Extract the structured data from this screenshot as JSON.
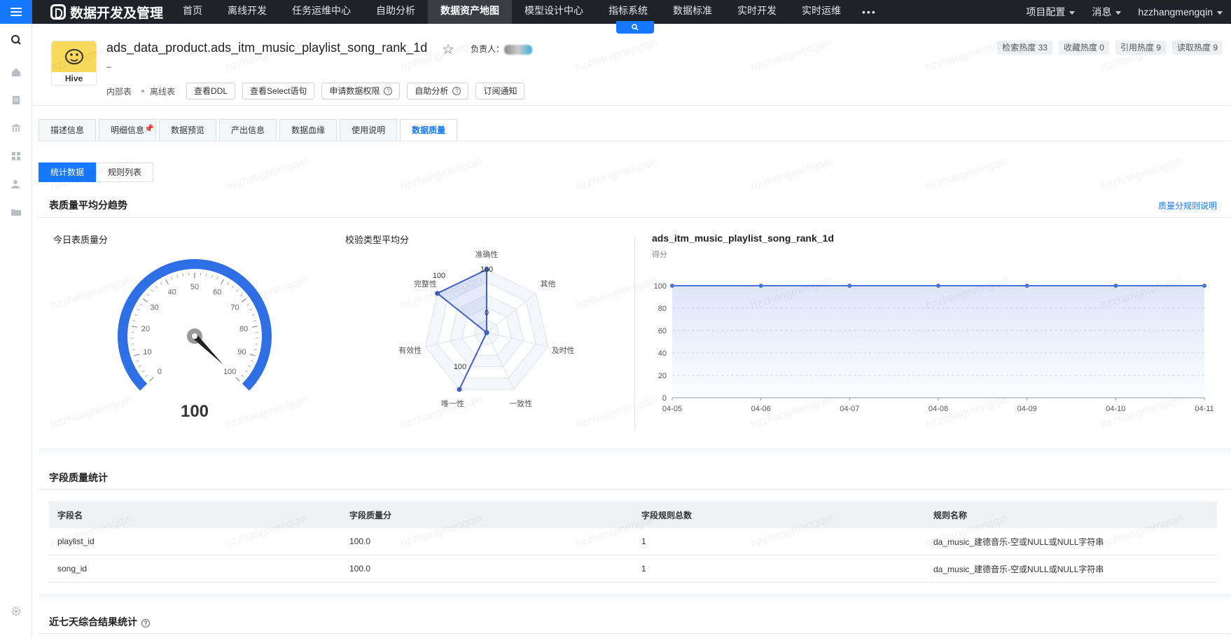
{
  "app": {
    "title": "数据开发及管理"
  },
  "nav": {
    "items": [
      "首页",
      "离线开发",
      "任务运维中心",
      "自助分析",
      "数据资产地图",
      "模型设计中心",
      "指标系统",
      "数据标准",
      "实时开发",
      "实时运维"
    ],
    "active": "数据资产地图",
    "more": "•••",
    "right": [
      "项目配置",
      "消息",
      "hzzhangmengqin"
    ]
  },
  "asset": {
    "engine_label": "Hive",
    "table_name": "ads_data_product.ads_itm_music_playlist_song_rank_1d",
    "dash": "–",
    "owner_label": "负责人：",
    "meta": [
      "内部表",
      "离线表"
    ],
    "actions": [
      "查看DDL",
      "查看Select语句",
      "申请数据权限",
      "自助分析",
      "订阅通知"
    ],
    "heat": [
      "检索热度 33",
      "收藏热度 0",
      "引用热度 9",
      "读取热度 9"
    ]
  },
  "tabs": [
    "描述信息",
    "明细信息",
    "数据预览",
    "产出信息",
    "数据血缘",
    "使用说明",
    "数据质量"
  ],
  "tabs_active": "数据质量",
  "subtabs": [
    "统计数据",
    "规则列表"
  ],
  "subtabs_active": "统计数据",
  "trend": {
    "title": "表质量平均分趋势",
    "help_link": "质量分规则说明",
    "gauge_title": "今日表质量分",
    "gauge_value": "100",
    "radar_title": "校验类型平均分",
    "line_title": "ads_itm_music_playlist_song_rank_1d",
    "line_subtitle": "得分"
  },
  "chart_data": [
    {
      "type": "gauge",
      "title": "今日表质量分",
      "value": 100,
      "min": 0,
      "max": 100,
      "ticks": [
        "0",
        "10",
        "20",
        "30",
        "40",
        "50",
        "60",
        "70",
        "80",
        "90",
        "100"
      ]
    },
    {
      "type": "radar",
      "title": "校验类型平均分",
      "indicators": [
        "准确性",
        "其他",
        "及时性",
        "一致性",
        "唯一性",
        "有效性",
        "完整性"
      ],
      "values": [
        100,
        0,
        0,
        0,
        100,
        0,
        100
      ],
      "max": 100,
      "labels": [
        "100",
        "0",
        "100",
        "100"
      ]
    },
    {
      "type": "area",
      "categories": [
        "04-05",
        "04-06",
        "04-07",
        "04-08",
        "04-09",
        "04-10",
        "04-11"
      ],
      "series": [
        {
          "values": [
            100,
            100,
            100,
            100,
            100,
            100,
            100
          ]
        }
      ],
      "ylim": [
        0,
        100
      ],
      "yticks": [
        0,
        20,
        40,
        60,
        80,
        100
      ],
      "grid": true,
      "color": "#4a73d8"
    }
  ],
  "field_quality": {
    "title": "字段质量统计",
    "columns": [
      "字段名",
      "字段质量分",
      "字段规则总数",
      "规则名称"
    ],
    "rows": [
      [
        "playlist_id",
        "100.0",
        "1",
        "da_music_建德音乐-空或NULL或NULL字符串"
      ],
      [
        "song_id",
        "100.0",
        "1",
        "da_music_建德音乐-空或NULL或NULL字符串"
      ]
    ]
  },
  "seven_day": {
    "title": "近七天综合结果统计"
  },
  "watermark": "hzzhangmengqin"
}
